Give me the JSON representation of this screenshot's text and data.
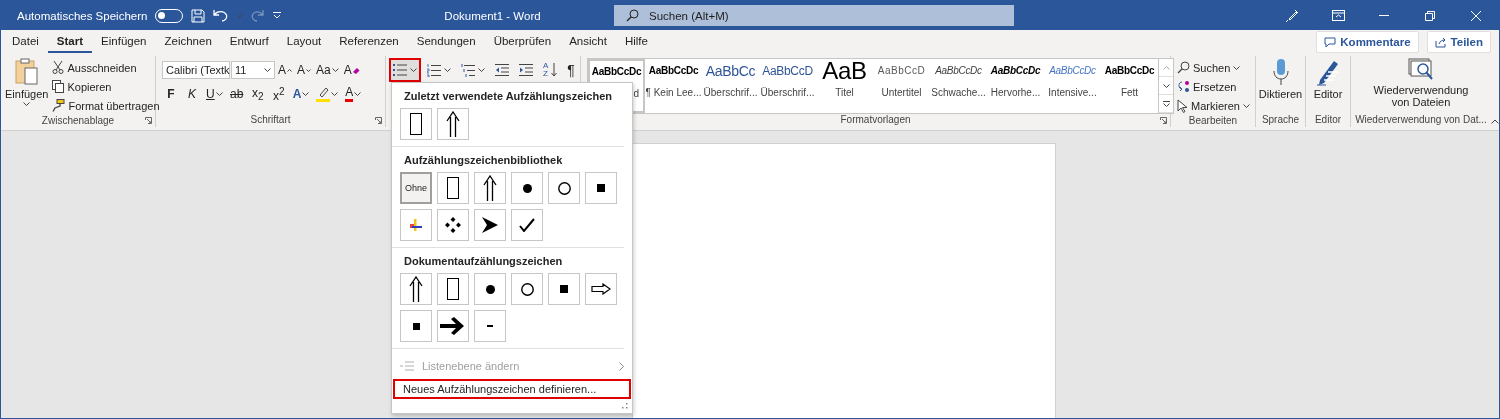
{
  "title_bar": {
    "autosave_label": "Automatisches Speichern",
    "autosave_on": false,
    "redo_disabled": true,
    "document_title": "Dokument1  -  Word",
    "search_placeholder": "Suchen (Alt+M)"
  },
  "tabs": [
    {
      "label": "Datei",
      "selected": false
    },
    {
      "label": "Start",
      "selected": true
    },
    {
      "label": "Einfügen",
      "selected": false
    },
    {
      "label": "Zeichnen",
      "selected": false
    },
    {
      "label": "Entwurf",
      "selected": false
    },
    {
      "label": "Layout",
      "selected": false
    },
    {
      "label": "Referenzen",
      "selected": false
    },
    {
      "label": "Sendungen",
      "selected": false
    },
    {
      "label": "Überprüfen",
      "selected": false
    },
    {
      "label": "Ansicht",
      "selected": false
    },
    {
      "label": "Hilfe",
      "selected": false
    }
  ],
  "actions": [
    {
      "kind": "comments",
      "label": "Kommentare"
    },
    {
      "kind": "share",
      "label": "Teilen"
    }
  ],
  "ribbon": {
    "clipboard": {
      "paste": "Einfügen",
      "items": [
        {
          "kind": "cut",
          "label": "Ausschneiden"
        },
        {
          "kind": "copy",
          "label": "Kopieren"
        },
        {
          "kind": "painter",
          "label": "Format übertragen"
        }
      ],
      "label": "Zwischenablage"
    },
    "font": {
      "font_name": "Calibri (Textk",
      "font_size": "11",
      "row1": [
        {
          "kind": "grow",
          "text": "A"
        },
        {
          "kind": "shrink",
          "text": "A"
        },
        {
          "kind": "case",
          "text": "Aa"
        },
        {
          "kind": "clear",
          "text": "A"
        }
      ],
      "row2": [
        {
          "kind": "bold",
          "text": "F"
        },
        {
          "kind": "italic",
          "text": "K"
        },
        {
          "kind": "underline",
          "text": "U"
        },
        {
          "kind": "strike",
          "text": "ab"
        },
        {
          "kind": "script",
          "text": "x$_{2}$"
        },
        {
          "kind": "script",
          "text": "x$^{2}$"
        },
        {
          "kind": "effects",
          "text": "A"
        },
        {
          "kind": "highlight"
        },
        {
          "kind": "color",
          "text": "A"
        }
      ],
      "label": "Schriftart"
    },
    "paragraph": {
      "bullets_highlighted": true,
      "sort": [
        "A",
        "Z"
      ],
      "pilcrow": "¶"
    },
    "styles": {
      "items": [
        {
          "sample": "AaBbCcDc",
          "name": "d",
          "kind": "normal",
          "selected": true
        },
        {
          "sample": "AaBbCcDc",
          "name": "¶ Kein Lee...",
          "kind": "nospacing",
          "selected": false
        },
        {
          "sample": "AaBbCc",
          "name": "Überschrif...",
          "kind": "heading1",
          "selected": false
        },
        {
          "sample": "AaBbCcD",
          "name": "Überschrif...",
          "kind": "heading2",
          "selected": false
        },
        {
          "sample": "AaB",
          "name": "Titel",
          "kind": "title",
          "selected": false
        },
        {
          "sample": "AaBbCcD",
          "name": "Untertitel",
          "kind": "subtitle",
          "selected": false
        },
        {
          "sample": "AaBbCcDc",
          "name": "Schwache...",
          "kind": "subtle",
          "selected": false
        },
        {
          "sample": "AaBbCcDc",
          "name": "Hervorhe...",
          "kind": "emphasis",
          "selected": false
        },
        {
          "sample": "AaBbCcDc",
          "name": "Intensive...",
          "kind": "intense",
          "selected": false
        },
        {
          "sample": "AaBbCcDc",
          "name": "Fett",
          "kind": "strong",
          "selected": false
        }
      ],
      "label": "Formatvorlagen"
    },
    "editing": {
      "items": [
        {
          "kind": "find",
          "label": "Suchen"
        },
        {
          "kind": "replace",
          "label": "Ersetzen"
        },
        {
          "kind": "select",
          "label": "Markieren"
        }
      ],
      "label": "Bearbeiten"
    },
    "voice": {
      "button": "Diktieren",
      "label": "Sprache"
    },
    "editor": {
      "button": "Editor",
      "label": "Editor"
    },
    "reuse": {
      "button": "Wiederverwendung von Dateien",
      "label": "Wiederverwendung von Dat..."
    }
  },
  "bullet_menu": {
    "sections": [
      {
        "title": "Zuletzt verwendete Aufzählungszeichen",
        "items": [
          {
            "kind": "rectangle",
            "selected": false
          },
          {
            "kind": "double-arrow",
            "selected": false
          }
        ]
      },
      {
        "title": "Aufzählungszeichenbibliothek",
        "items": [
          {
            "kind": "none",
            "text": "Ohne",
            "selected": true
          },
          {
            "kind": "rectangle",
            "selected": false
          },
          {
            "kind": "double-arrow",
            "selected": false
          },
          {
            "kind": "dot",
            "selected": false
          },
          {
            "kind": "circle",
            "selected": false
          },
          {
            "kind": "square",
            "selected": false
          },
          {
            "kind": "flag",
            "selected": false
          },
          {
            "kind": "diamonds",
            "selected": false
          },
          {
            "kind": "arrowhead",
            "selected": false
          },
          {
            "kind": "check",
            "selected": false
          }
        ]
      },
      {
        "title": "Dokumentaufzählungszeichen",
        "items": [
          {
            "kind": "double-arrow",
            "selected": false
          },
          {
            "kind": "rectangle",
            "selected": false
          },
          {
            "kind": "dot",
            "selected": false
          },
          {
            "kind": "circle",
            "selected": false
          },
          {
            "kind": "square",
            "selected": false
          },
          {
            "kind": "outline-arrow",
            "selected": false
          },
          {
            "kind": "small-square",
            "selected": false
          },
          {
            "kind": "bold-arrow",
            "selected": false
          },
          {
            "kind": "dash",
            "selected": false
          }
        ]
      }
    ],
    "list_level": {
      "label": "Listenebene ändern",
      "disabled": true
    },
    "define": {
      "label": "Neues Aufzählungszeichen definieren...",
      "highlighted": true
    }
  }
}
